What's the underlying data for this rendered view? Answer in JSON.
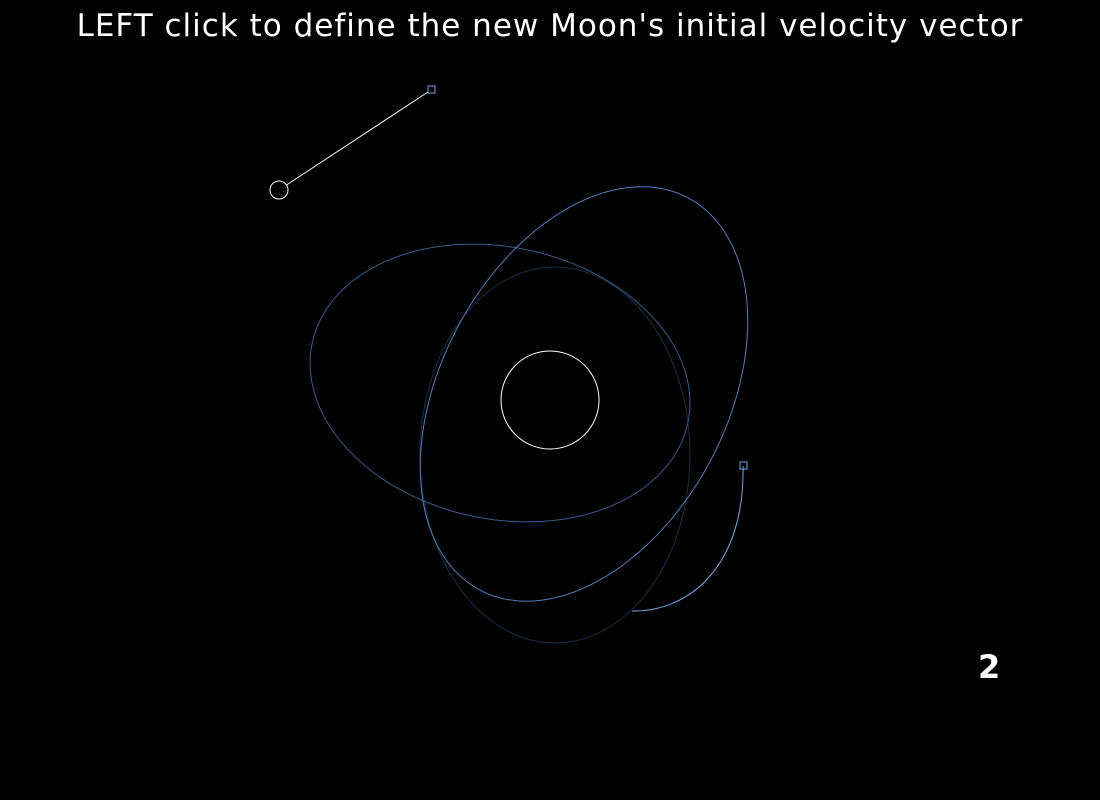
{
  "instruction": "LEFT click to define the new Moon's initial velocity vector",
  "moon_count": "2",
  "colors": {
    "background": "#000000",
    "text": "#ffffff",
    "planet": "#ffffff",
    "orbit_a": "#2f5f8f",
    "orbit_b": "#4a7fbf",
    "orbit_faint": "#18304a",
    "vector": "#ffffff",
    "moon_marker": "#6fa8e8"
  },
  "icons": {
    "planet": "circle-outline",
    "new_moon": "circle-outline",
    "vector_handle": "square-outline",
    "existing_moon": "square-outline"
  }
}
